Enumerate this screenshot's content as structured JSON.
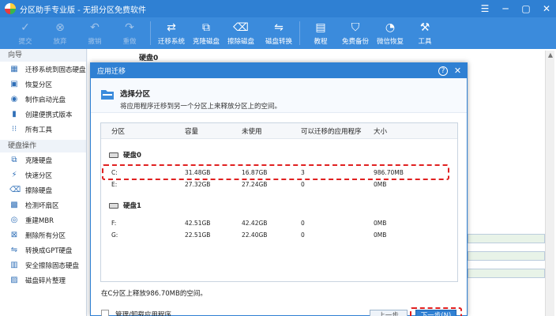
{
  "window": {
    "title": "分区助手专业版 - 无损分区免费软件"
  },
  "toolbar": {
    "buttons": [
      {
        "label": "提交",
        "icon": "checkmark-icon",
        "disabled": true
      },
      {
        "label": "放弃",
        "icon": "cancel-icon",
        "disabled": true
      },
      {
        "label": "撤销",
        "icon": "undo-icon",
        "disabled": true
      },
      {
        "label": "重做",
        "icon": "redo-icon",
        "disabled": true
      },
      {
        "label": "迁移系统",
        "icon": "migrate-system-icon",
        "disabled": false
      },
      {
        "label": "克隆磁盘",
        "icon": "clone-disk-icon",
        "disabled": false
      },
      {
        "label": "擦除磁盘",
        "icon": "wipe-disk-icon",
        "disabled": false
      },
      {
        "label": "磁盘转换",
        "icon": "disk-convert-icon",
        "disabled": false
      },
      {
        "label": "教程",
        "icon": "tutorial-icon",
        "disabled": false
      },
      {
        "label": "免费备份",
        "icon": "backup-icon",
        "disabled": false
      },
      {
        "label": "微信恢复",
        "icon": "wechat-recovery-icon",
        "disabled": false
      },
      {
        "label": "工具",
        "icon": "tools-icon",
        "disabled": false
      }
    ]
  },
  "sidebar": {
    "wizard_heading": "向导",
    "wizard_items": [
      "迁移系统到固态硬盘",
      "恢复分区",
      "制作启动光盘",
      "创建便携式版本",
      "所有工具"
    ],
    "disk_ops_heading": "硬盘操作",
    "disk_items": [
      "克隆硬盘",
      "快速分区",
      "擦除硬盘",
      "检测坏扇区",
      "重建MBR",
      "删除所有分区",
      "转换成GPT硬盘",
      "安全擦除固态硬盘",
      "磁盘碎片整理"
    ]
  },
  "background": {
    "disk_label": "硬盘0"
  },
  "dialog": {
    "title": "应用迁移",
    "header_title": "选择分区",
    "header_subtitle": "将应用程序迁移到另一个分区上来释放分区上的空间。",
    "columns": [
      "分区",
      "容量",
      "未使用",
      "可以迁移的应用程序",
      "大小"
    ],
    "disks": [
      {
        "name": "硬盘0",
        "partitions": [
          {
            "name": "C:",
            "capacity": "31.48GB",
            "unused": "16.87GB",
            "apps": "3",
            "size": "986.70MB"
          },
          {
            "name": "E:",
            "capacity": "27.32GB",
            "unused": "27.24GB",
            "apps": "0",
            "size": "0MB"
          }
        ]
      },
      {
        "name": "硬盘1",
        "partitions": [
          {
            "name": "F:",
            "capacity": "42.51GB",
            "unused": "42.42GB",
            "apps": "0",
            "size": "0MB"
          },
          {
            "name": "G:",
            "capacity": "22.51GB",
            "unused": "22.40GB",
            "apps": "0",
            "size": "0MB"
          }
        ]
      }
    ],
    "info_text": "在C分区上释放986.70MB的空间。",
    "checkbox_label": "管理/卸载应用程序",
    "prev_label": "上一步",
    "next_label": "下一步(N)"
  },
  "colors": {
    "accent": "#2f80d3",
    "highlight": "#e02020"
  }
}
